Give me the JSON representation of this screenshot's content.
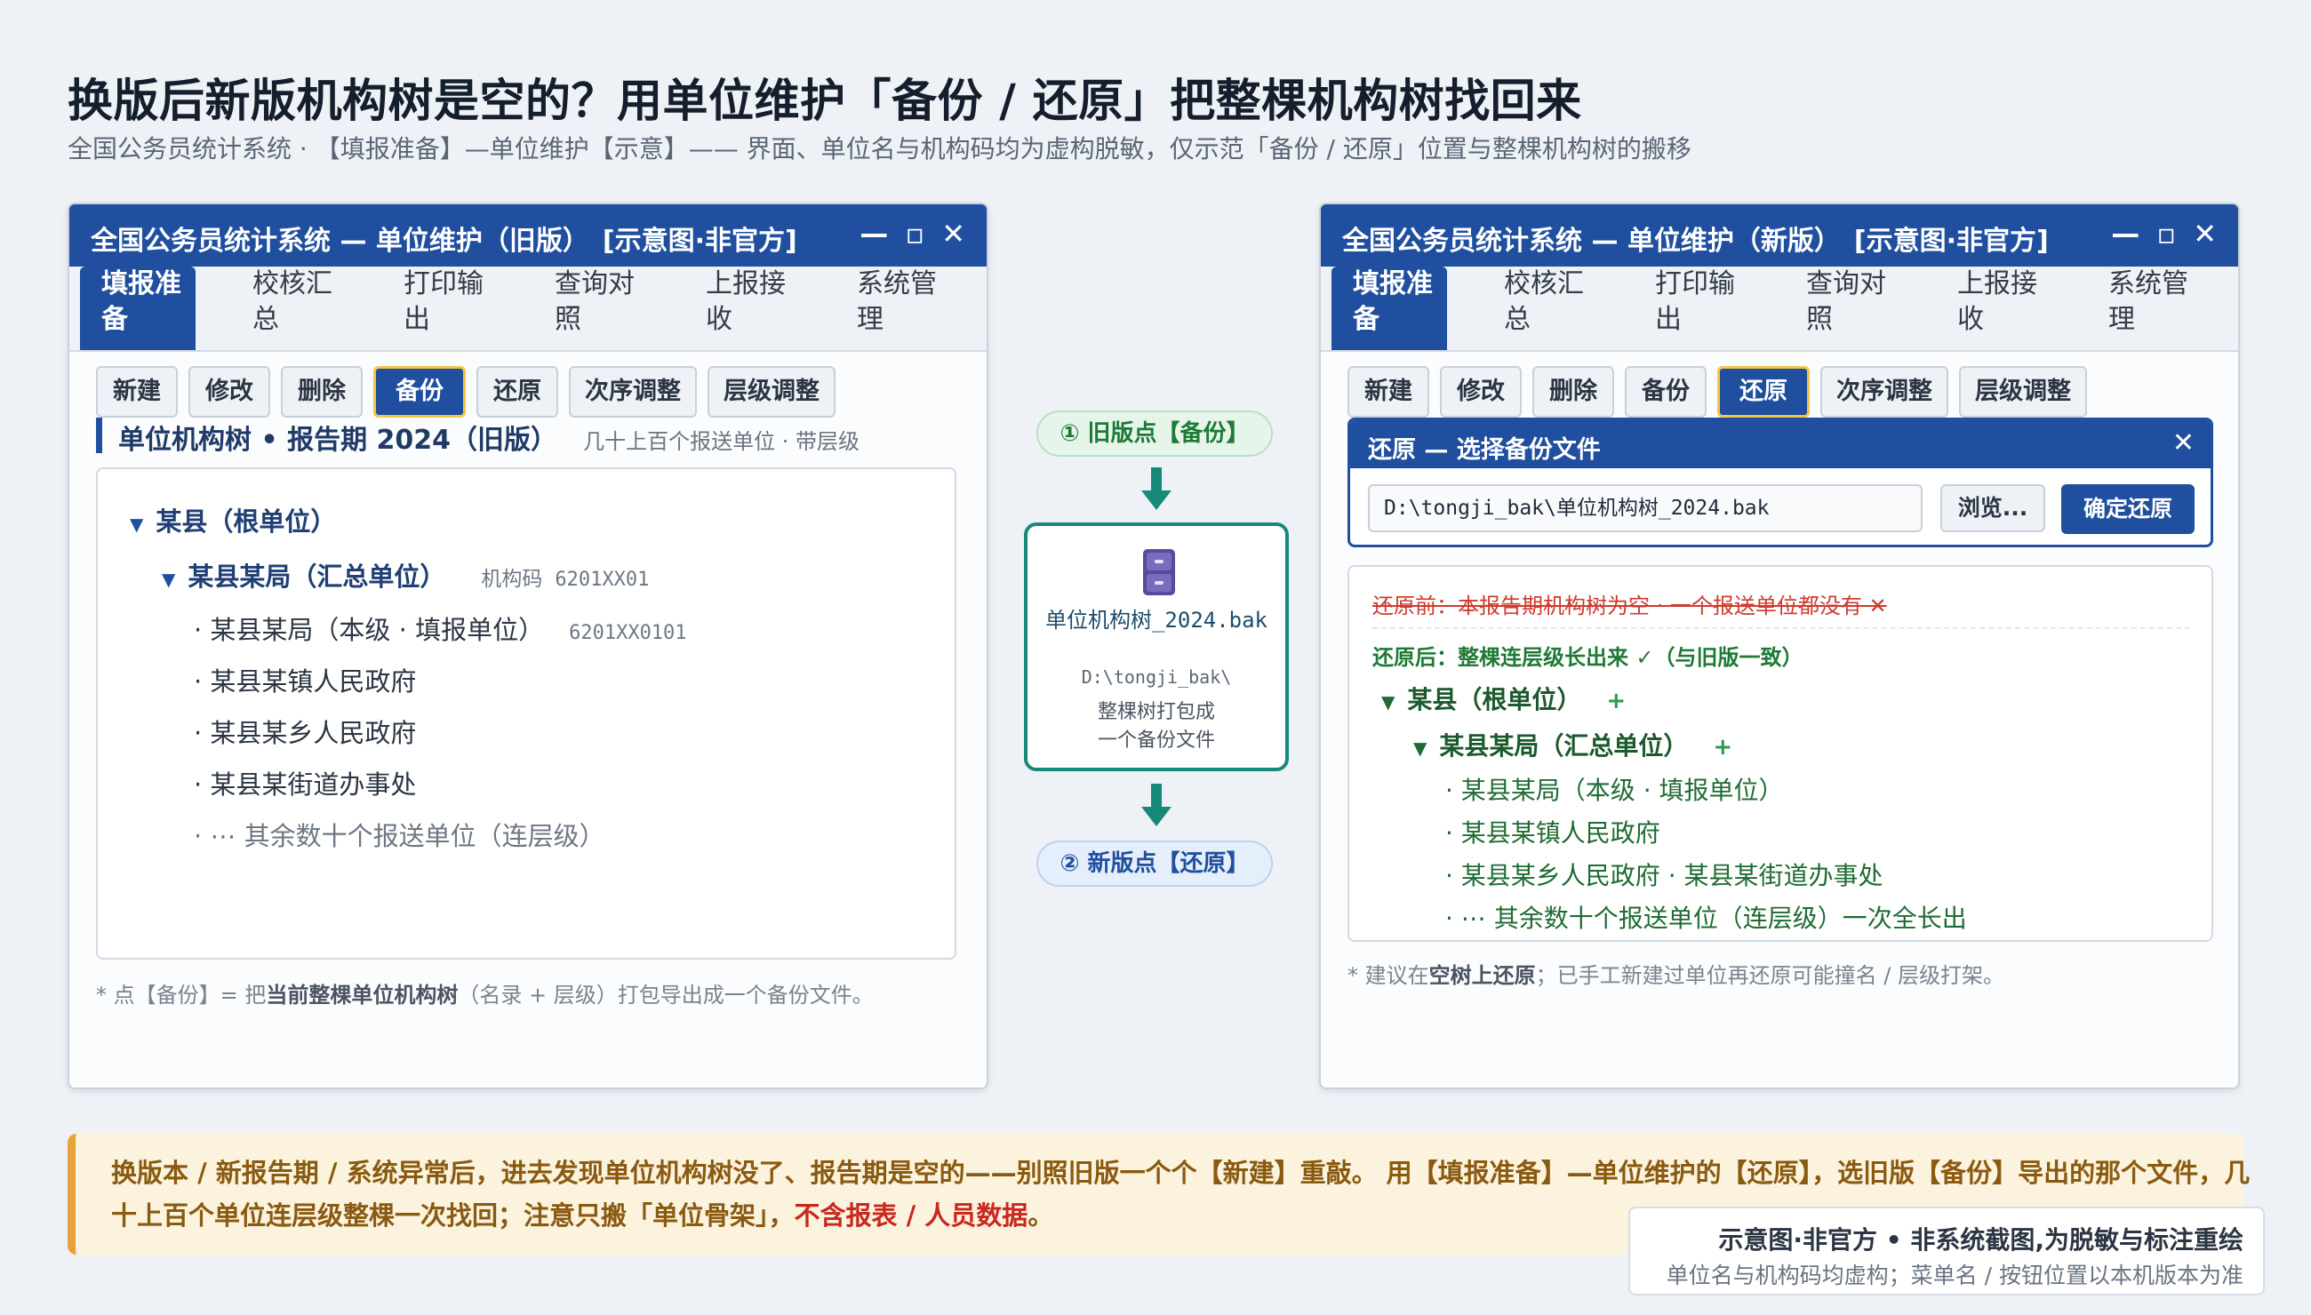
{
  "page": {
    "title": "换版后新版机构树是空的？用单位维护「备份 / 还原」把整棵机构树找回来",
    "subtitle": "全国公务员统计系统 · 【填报准备】—单位维护【示意】—— 界面、单位名与机构码均为虚构脱敏，仅示范「备份 / 还原」位置与整棵机构树的搬移"
  },
  "window_controls": "— ▫ ✕",
  "menu": [
    "填报准备",
    "校核汇总",
    "打印输出",
    "查询对照",
    "上报接收",
    "系统管理"
  ],
  "toolbar": [
    "新建",
    "修改",
    "删除",
    "备份",
    "还原",
    "次序调整",
    "层级调整"
  ],
  "old_window": {
    "title": "全国公务员统计系统 — 单位维护（旧版）　[示意图·非官方]",
    "section_title": "单位机构树 • 报告期 2024（旧版）",
    "section_hint": "几十上百个报送单位 · 带层级",
    "tree": {
      "root": "某县（根单位）",
      "l1": "某县某局（汇总单位）",
      "l1_code_label": "机构码",
      "l1_code": "6201XX01",
      "child1": "· 某县某局（本级 · 填报单位）",
      "child1_code": "6201XX0101",
      "child2": "· 某县某镇人民政府",
      "child3": "· 某县某乡人民政府",
      "child4": "· 某县某街道办事处",
      "child5": "· ⋯ 其余数十个报送单位（连层级）"
    },
    "note_prefix": "* 点【备份】= 把",
    "note_bold": "当前整棵单位机构树",
    "note_suffix": "（名录 + 层级）打包导出成一个备份文件。"
  },
  "flow": {
    "old_point": "① 旧版点【备份】",
    "file_name": "单位机构树_2024.bak",
    "file_path": "D:\\tongji_bak\\",
    "file_desc_1": "整棵树打包成",
    "file_desc_2": "一个备份文件",
    "new_point": "② 新版点【还原】"
  },
  "new_window": {
    "title": "全国公务员统计系统 — 单位维护（新版）　[示意图·非官方]",
    "dialog_title": "还原 — 选择备份文件",
    "dialog_close": "✕",
    "dialog_path": "D:\\tongji_bak\\单位机构树_2024.bak",
    "browse_label": "浏览...",
    "confirm_label": "确定还原",
    "before_text": "还原前：本报告期机构树为空 · 一个报送单位都没有 ✕",
    "after_text": "还原后：整棵连层级长出来 ✓（与旧版一致）",
    "tree": {
      "root": "某县（根单位）",
      "l1": "某县某局（汇总单位）",
      "plus": "+",
      "child1": "· 某县某局（本级 · 填报单位）",
      "child2": "· 某县某镇人民政府",
      "child3": "· 某县某乡人民政府 · 某县某街道办事处",
      "child4": "· ⋯ 其余数十个报送单位（连层级）一次全长出"
    },
    "note_prefix": "* 建议在",
    "note_bold": "空树上还原",
    "note_suffix": "；已手工新建过单位再还原可能撞名 / 层级打架。"
  },
  "callout": {
    "text_main": "换版本 / 新报告期 / 系统异常后，进去发现单位机构树没了、报告期是空的——别照旧版一个个【新建】重敲。 用【填报准备】—单位维护的【还原】，选旧版【备份】导出的那个文件，几十上百个单位连层级整棵一次找回；注意只搬「单位骨架」，",
    "text_red": "不含报表 / 人员数据",
    "text_end": "。"
  },
  "disclaimer": {
    "line1": "示意图·非官方 • 非系统截图,为脱敏与标注重绘",
    "line2": "单位名与机构码均虚构；菜单名 / 按钮位置以本机版本为准"
  },
  "colors": {
    "brand_blue": "#1f4f9e",
    "highlight_gold": "#f4c542",
    "success_green": "#1f7a36",
    "error_red": "#d03a2f",
    "callout_bg": "#fbf3de",
    "callout_accent": "#e8a23a",
    "file_border": "#17897a"
  },
  "icons": {
    "file_icon": "file-cabinet-icon",
    "arrow": "arrow-down-icon"
  },
  "state": {
    "active_menu": "填报准备",
    "old_highlighted_button": "备份",
    "new_highlighted_button": "还原"
  }
}
